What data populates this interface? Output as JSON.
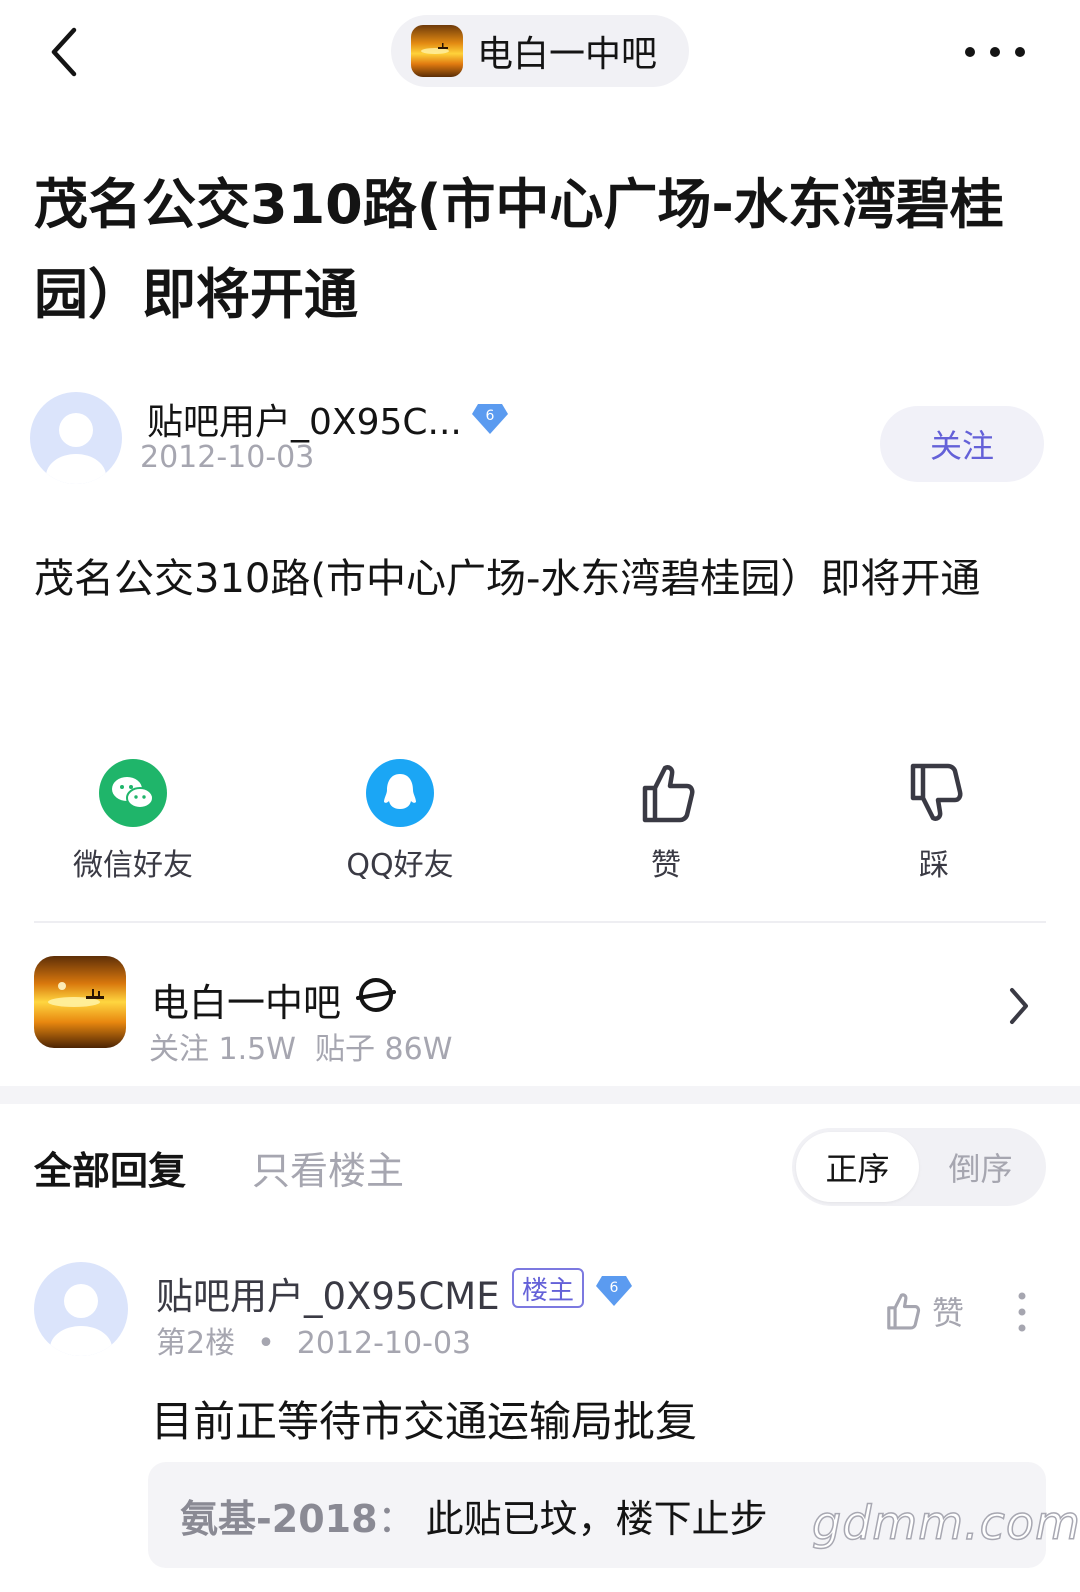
{
  "header": {
    "forum_name": "电白一中吧",
    "back_icon": "chevron-left-icon",
    "more_icon": "more-dots-icon"
  },
  "post": {
    "title": "茂名公交310路(市中心广场-水东湾碧桂园）即将开通",
    "author": {
      "name": "贴吧用户_0X95C...",
      "level": "6",
      "date": "2012-10-03"
    },
    "follow_label": "关注",
    "body": "茂名公交310路(市中心广场-水东湾碧桂园）即将开通"
  },
  "actions": [
    {
      "label": "微信好友",
      "icon": "wechat-icon",
      "color": "#1fb56a"
    },
    {
      "label": "QQ好友",
      "icon": "qq-icon",
      "color": "#1ba6f5"
    },
    {
      "label": "赞",
      "icon": "thumb-up-icon"
    },
    {
      "label": "踩",
      "icon": "thumb-down-icon"
    }
  ],
  "forum_card": {
    "name": "电白一中吧",
    "stats": "关注 1.5W  贴子 86W"
  },
  "replies_header": {
    "tab_all": "全部回复",
    "tab_op_only": "只看楼主",
    "sort_asc": "正序",
    "sort_desc": "倒序"
  },
  "reply": {
    "name": "贴吧用户_0X95CME",
    "op_tag": "楼主",
    "level": "6",
    "floor": "第2楼",
    "separator": "•",
    "date": "2012-10-03",
    "like_label": "赞",
    "text": "目前正等待市交通运输局批复",
    "quote": {
      "name": "氨基-2018",
      "separator": "：",
      "text": "此贴已坟，楼下止步"
    }
  },
  "watermark": "gdmm.com",
  "colors": {
    "accent": "#6461d8",
    "badge_blue": "#5b9bf0",
    "muted_text": "#a6a6b0"
  }
}
